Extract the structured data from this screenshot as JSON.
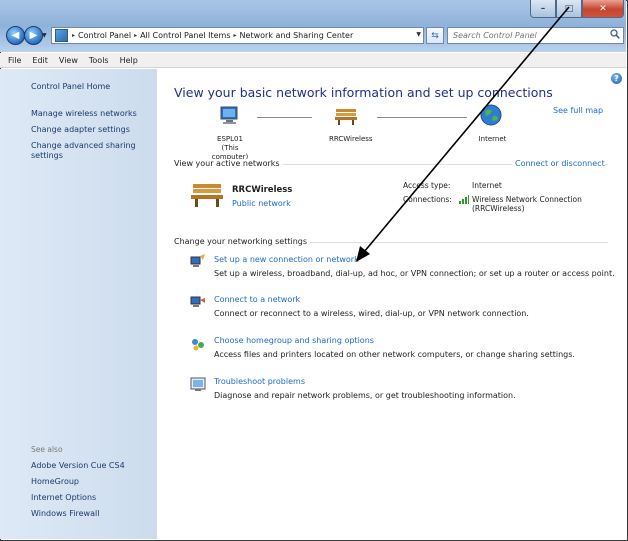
{
  "window": {
    "minimize": "–",
    "maximize": "□",
    "close": "✕"
  },
  "nav": {
    "breadcrumbs": [
      "Control Panel",
      "All Control Panel Items",
      "Network and Sharing Center"
    ],
    "search_placeholder": "Search Control Panel",
    "icons": [
      "back-arrow-icon",
      "forward-arrow-icon",
      "control-panel-icon",
      "refresh-icon",
      "search-icon"
    ]
  },
  "menu": [
    "File",
    "Edit",
    "View",
    "Tools",
    "Help"
  ],
  "sidebar": {
    "home": "Control Panel Home",
    "links": [
      "Manage wireless networks",
      "Change adapter settings",
      "Change advanced sharing settings"
    ],
    "see_also_label": "See also",
    "see_also": [
      "Adobe Version Cue CS4",
      "HomeGroup",
      "Internet Options",
      "Windows Firewall"
    ]
  },
  "main": {
    "title": "View your basic network information and set up connections",
    "see_full_map": "See full map",
    "map": {
      "computer_name": "ESPL01",
      "computer_sub": "(This computer)",
      "network_name": "RRCWireless",
      "internet": "Internet"
    },
    "active_label": "View your active networks",
    "connect_disconnect": "Connect or disconnect",
    "network": {
      "name": "RRCWireless",
      "type": "Public network",
      "access_type_label": "Access type:",
      "access_type_value": "Internet",
      "connections_label": "Connections:",
      "connection_value_line1": "Wireless Network Connection",
      "connection_value_line2": "(RRCWireless)"
    },
    "settings_label": "Change your networking settings",
    "tasks": [
      {
        "title": "Set up a new connection or network",
        "desc": "Set up a wireless, broadband, dial-up, ad hoc, or VPN connection; or set up a router or access point."
      },
      {
        "title": "Connect to a network",
        "desc": "Connect or reconnect to a wireless, wired, dial-up, or VPN network connection."
      },
      {
        "title": "Choose homegroup and sharing options",
        "desc": "Access files and printers located on other network computers, or change sharing settings."
      },
      {
        "title": "Troubleshoot problems",
        "desc": "Diagnose and repair network problems, or get troubleshooting information."
      }
    ]
  },
  "colors": {
    "link": "#1f69c6",
    "title": "#1e3287",
    "sidebar_text": "#1c3a6b"
  }
}
